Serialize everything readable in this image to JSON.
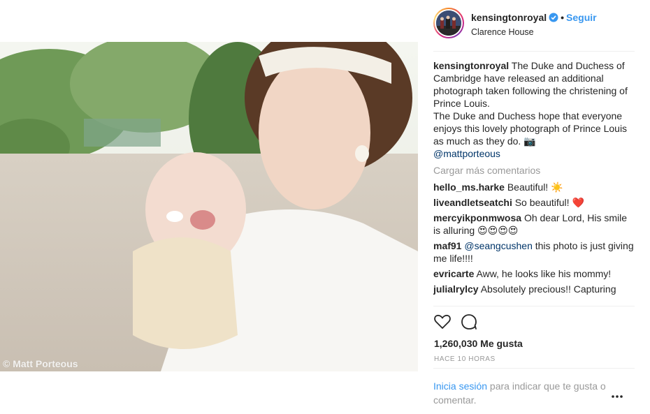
{
  "photo": {
    "credit": "© Matt Porteous"
  },
  "header": {
    "username": "kensingtonroyal",
    "separator": "•",
    "follow_label": "Seguir",
    "location": "Clarence House"
  },
  "caption": {
    "username": "kensingtonroyal",
    "text": " The Duke and Duchess of Cambridge have released an additional photograph taken following the christening of Prince Louis.\nThe Duke and Duchess hope that everyone enjoys this lovely photograph of Prince Louis as much as they do. 📷",
    "mention": "@mattporteous"
  },
  "load_more": "Cargar más comentarios",
  "comments": [
    {
      "username": "hello_ms.harke",
      "text": " Beautiful! ☀️"
    },
    {
      "username": "liveandletseatchi",
      "text": " So beautiful! ❤️"
    },
    {
      "username": "mercyikponmwosa",
      "text": " Oh dear Lord, His smile is alluring 😍😍😍😍"
    },
    {
      "username": "maf91",
      "mention": " @seangcushen",
      "text": " this photo is just giving me life!!!!"
    },
    {
      "username": "evricarte",
      "text": " Aww, he looks like his mommy!"
    },
    {
      "username": "julialrylcy",
      "text": " Absolutely precious!! Capturing"
    }
  ],
  "actions": {
    "like_icon": "heart-icon",
    "comment_icon": "comment-icon"
  },
  "likes": "1,260,030 Me gusta",
  "time": "HACE 10 HORAS",
  "login": {
    "link": "Inicia sesión",
    "text": " para indicar que te gusta o comentar."
  },
  "more_icon": "more-options-icon",
  "colors": {
    "accent": "#3897f0",
    "muted": "#999999",
    "mention": "#003569"
  }
}
